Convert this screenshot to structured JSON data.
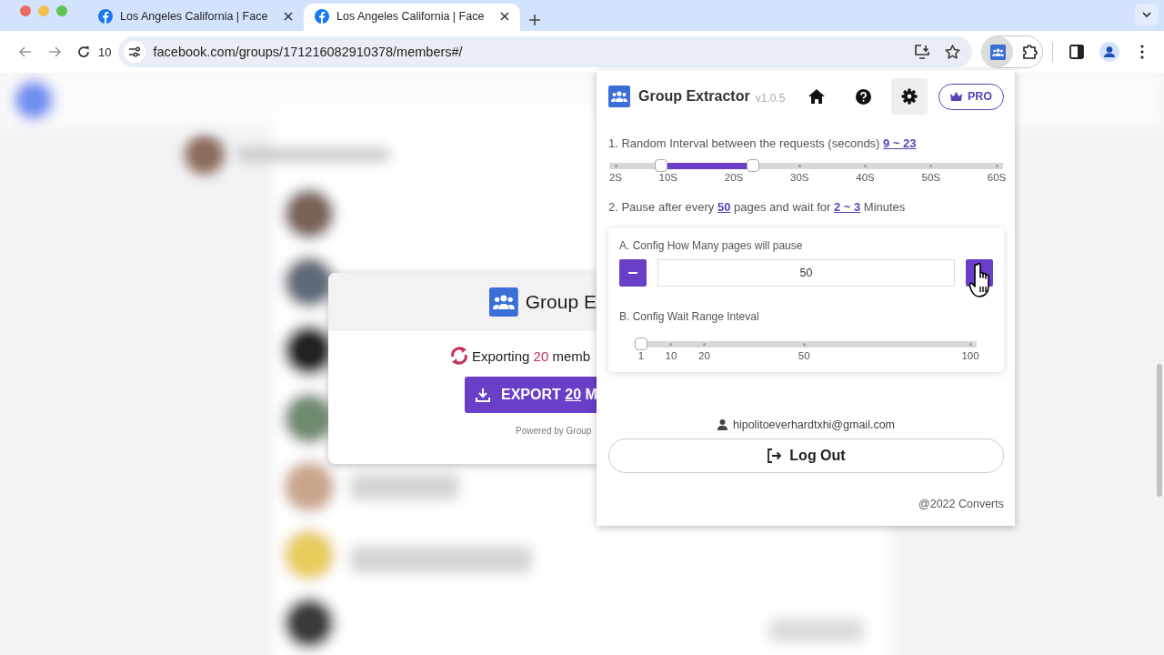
{
  "browser": {
    "tabs": [
      {
        "title": "Los Angeles California | Face",
        "selected": false
      },
      {
        "title": "Los Angeles California | Face",
        "selected": true
      }
    ],
    "reload_count": "10",
    "url": "facebook.com/groups/171216082910378/members#/"
  },
  "export_modal": {
    "title": "Group E",
    "status": {
      "prefix": "Exporting",
      "count": "20",
      "suffix": "memb"
    },
    "export_button": {
      "prefix": "EXPORT",
      "count": "20",
      "suffix": "M"
    },
    "footer": "Powered by Group"
  },
  "extension_popup": {
    "title": "Group Extractor",
    "version": "v1.0.5",
    "nav": [
      {
        "kind": "home",
        "selected": false
      },
      {
        "kind": "help",
        "selected": false
      },
      {
        "kind": "settings",
        "selected": true
      }
    ],
    "pro_button": "PRO",
    "interval": {
      "parts": [
        {
          "kind": "text",
          "text": "1. Random Interval between the requests (seconds)"
        },
        {
          "kind": "link",
          "text": "9 ~ 23"
        }
      ],
      "slider": {
        "thumbs": [
          {
            "level": 0.12
          },
          {
            "level": 0.36
          }
        ],
        "ticks": [
          "2S",
          "10S",
          "20S",
          "30S",
          "40S",
          "50S",
          "60S"
        ]
      }
    },
    "pause": {
      "parts": [
        {
          "kind": "text",
          "text": "2. Pause after every"
        },
        {
          "kind": "link",
          "text": "50"
        },
        {
          "kind": "text",
          "text": "pages and wait for"
        },
        {
          "kind": "link",
          "text": "2 ~ 3"
        },
        {
          "kind": "text",
          "text": "Minutes"
        }
      ]
    },
    "config": {
      "pages_label": "A. Config How Many pages will pause",
      "pages_value": "50",
      "wait_label": "B. Config Wait Range Inteval",
      "wait_slider": {
        "thumbs": [
          {
            "level": 0
          }
        ],
        "ticks": [
          "1",
          "10",
          "20",
          "50",
          "100"
        ]
      }
    },
    "account": {
      "email": "hipolitoeverhardtxhi@gmail.com",
      "logout": "Log Out"
    },
    "footer": "@2022 Converts"
  }
}
